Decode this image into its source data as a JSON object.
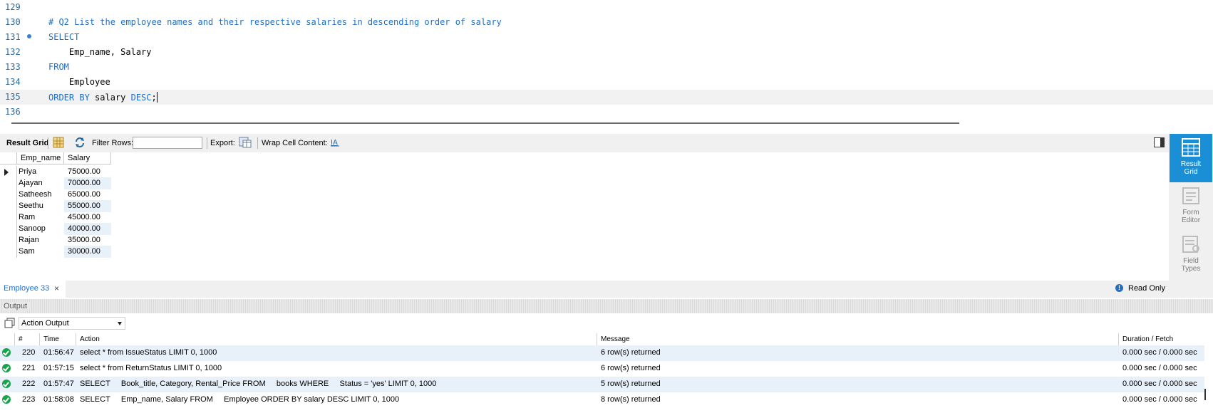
{
  "editor": {
    "lines": [
      {
        "num": "129",
        "parts": []
      },
      {
        "num": "130",
        "parts": [
          {
            "t": "# Q2 List the employee names and their respective salaries in descending order of salary",
            "c": "cm"
          }
        ]
      },
      {
        "num": "131",
        "marker": true,
        "parts": [
          {
            "t": "SELECT",
            "c": "kw"
          }
        ]
      },
      {
        "num": "132",
        "parts": [
          {
            "t": "    Emp_name, Salary",
            "c": ""
          }
        ]
      },
      {
        "num": "133",
        "parts": [
          {
            "t": "FROM",
            "c": "kw"
          }
        ]
      },
      {
        "num": "134",
        "parts": [
          {
            "t": "    Employee",
            "c": ""
          }
        ]
      },
      {
        "num": "135",
        "current": true,
        "parts": [
          {
            "t": "ORDER BY",
            "c": "kw"
          },
          {
            "t": " salary ",
            "c": ""
          },
          {
            "t": "DESC",
            "c": "kw"
          },
          {
            "t": ";",
            "c": ""
          }
        ]
      },
      {
        "num": "136",
        "parts": []
      }
    ]
  },
  "result_toolbar": {
    "result_grid_label": "Result Grid",
    "filter_rows_label": "Filter Rows:",
    "filter_value": "",
    "export_label": "Export:",
    "wrap_label": "Wrap Cell Content:"
  },
  "grid": {
    "columns": [
      "Emp_name",
      "Salary"
    ],
    "rows": [
      [
        "Priya",
        "75000.00"
      ],
      [
        "Ajayan",
        "70000.00"
      ],
      [
        "Satheesh",
        "65000.00"
      ],
      [
        "Seethu",
        "55000.00"
      ],
      [
        "Ram",
        "45000.00"
      ],
      [
        "Sanoop",
        "40000.00"
      ],
      [
        "Rajan",
        "35000.00"
      ],
      [
        "Sam",
        "30000.00"
      ]
    ],
    "selected_row": 0
  },
  "side_panel": {
    "result_grid": "Result\nGrid",
    "form_editor": "Form\nEditor",
    "field_types": "Field\nTypes"
  },
  "tabs": {
    "employee_tab": "Employee 33",
    "close": "×",
    "read_only": "Read Only"
  },
  "output": {
    "title": "Output",
    "action_select": "Action Output",
    "headers": {
      "num": "#",
      "time": "Time",
      "action": "Action",
      "message": "Message",
      "duration": "Duration / Fetch"
    },
    "rows": [
      {
        "num": "220",
        "time": "01:56:47",
        "action": "select * from IssueStatus LIMIT 0, 1000",
        "message": "6 row(s) returned",
        "duration": "0.000 sec / 0.000 sec"
      },
      {
        "num": "221",
        "time": "01:57:15",
        "action": "select * from ReturnStatus LIMIT 0, 1000",
        "message": "6 row(s) returned",
        "duration": "0.000 sec / 0.000 sec"
      },
      {
        "num": "222",
        "time": "01:57:47",
        "action": "SELECT     Book_title, Category, Rental_Price FROM     books WHERE     Status = 'yes' LIMIT 0, 1000",
        "message": "5 row(s) returned",
        "duration": "0.000 sec / 0.000 sec"
      },
      {
        "num": "223",
        "time": "01:58:08",
        "action": "SELECT     Emp_name, Salary FROM     Employee ORDER BY salary DESC LIMIT 0, 1000",
        "message": "8 row(s) returned",
        "duration": "0.000 sec / 0.000 sec"
      }
    ]
  },
  "colors": {
    "accent": "#1b8fd6",
    "keyword": "#1f6fc4",
    "ok": "#19a34a"
  }
}
